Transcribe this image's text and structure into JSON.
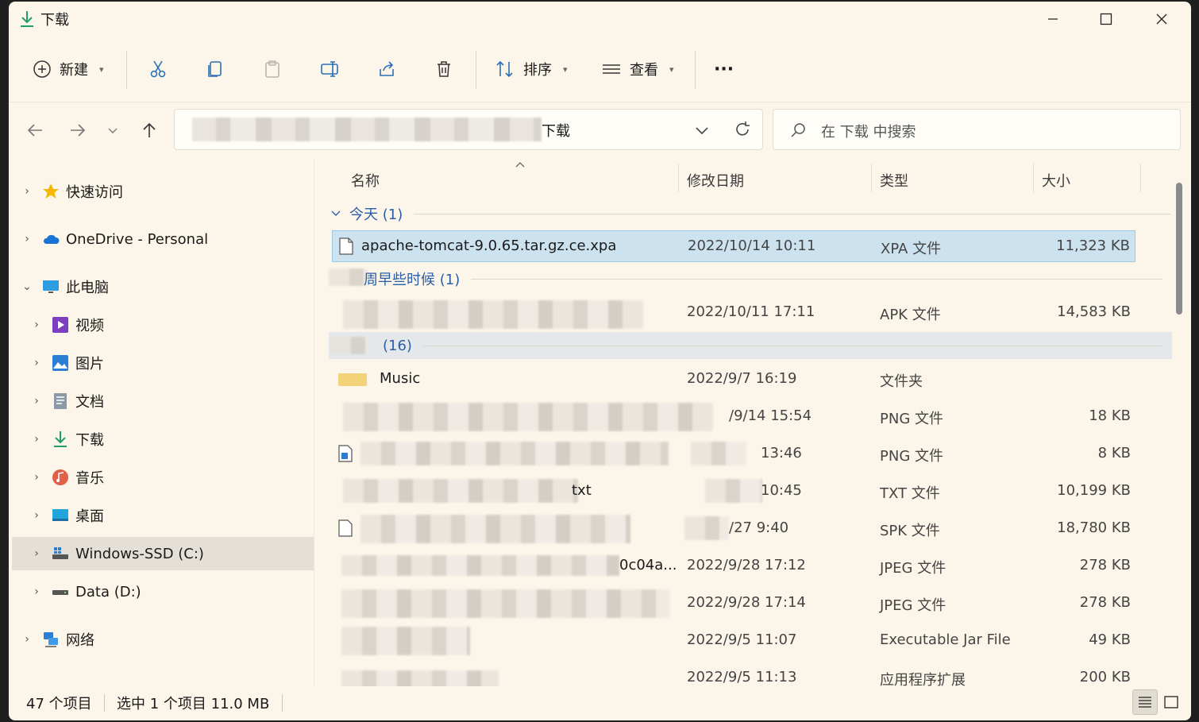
{
  "window": {
    "title": "下载",
    "minimize": "—",
    "maximize": "☐",
    "close": "✕"
  },
  "toolbar": {
    "new_label": "新建",
    "sort_label": "排序",
    "view_label": "查看",
    "more_label": "···"
  },
  "nav": {
    "address_tail": "下载",
    "search_placeholder": "在 下载 中搜索"
  },
  "sidebar": {
    "items": [
      {
        "label": "快速访问"
      },
      {
        "label": "OneDrive - Personal"
      },
      {
        "label": "此电脑"
      },
      {
        "label": "视频"
      },
      {
        "label": "图片"
      },
      {
        "label": "文档"
      },
      {
        "label": "下载"
      },
      {
        "label": "音乐"
      },
      {
        "label": "桌面"
      },
      {
        "label": "Windows-SSD (C:)"
      },
      {
        "label": "Data (D:)"
      },
      {
        "label": "网络"
      }
    ]
  },
  "columns": {
    "name": "名称",
    "date": "修改日期",
    "type": "类型",
    "size": "大小"
  },
  "groups": {
    "today": "今天 (1)",
    "earlier_week": "周早些时候 (1)",
    "earlier": "(16)"
  },
  "files": [
    {
      "name": "apache-tomcat-9.0.65.tar.gz.ce.xpa",
      "date": "2022/10/14 10:11",
      "type": "XPA 文件",
      "size": "11,323 KB"
    },
    {
      "name": "",
      "date": "2022/10/11 17:11",
      "type": "APK 文件",
      "size": "14,583 KB"
    },
    {
      "name": "Music",
      "date": "2022/9/7 16:19",
      "type": "文件夹",
      "size": ""
    },
    {
      "name": "",
      "date": "/9/14 15:54",
      "type": "PNG 文件",
      "size": "18 KB"
    },
    {
      "name": "",
      "date": "13:46",
      "type": "PNG 文件",
      "size": "8 KB"
    },
    {
      "name": "txt",
      "date": "10:45",
      "type": "TXT 文件",
      "size": "10,199 KB"
    },
    {
      "name": "",
      "date": "/27 9:40",
      "type": "SPK 文件",
      "size": "18,780 KB"
    },
    {
      "name": "0c04a...",
      "date": "2022/9/28 17:12",
      "type": "JPEG 文件",
      "size": "278 KB"
    },
    {
      "name": "",
      "date": "2022/9/28 17:14",
      "type": "JPEG 文件",
      "size": "278 KB"
    },
    {
      "name": "",
      "date": "2022/9/5 11:07",
      "type": "Executable Jar File",
      "size": "49 KB"
    },
    {
      "name": "",
      "date": "2022/9/5 11:13",
      "type": "应用程序扩展",
      "size": "200 KB"
    }
  ],
  "status": {
    "count": "47 个项目",
    "selection": "选中 1 个项目  11.0 MB"
  },
  "colors": {
    "window_bg": "#fcf6ea",
    "selection": "#cde2ef",
    "group_text": "#2a5ea8"
  }
}
